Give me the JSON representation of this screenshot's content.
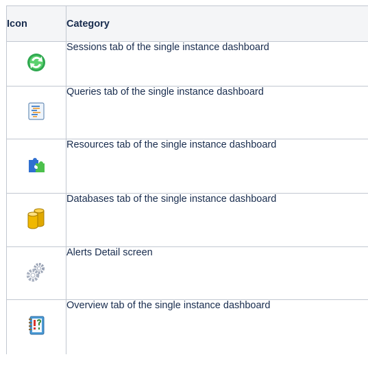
{
  "table": {
    "headers": {
      "icon": "Icon",
      "category": "Category"
    },
    "rows": [
      {
        "icon": "sessions-icon",
        "category": "Sessions tab of the single instance dashboard"
      },
      {
        "icon": "queries-icon",
        "category": "Queries tab of the single instance dashboard"
      },
      {
        "icon": "resources-icon",
        "category": "Resources tab of the single instance dashboard"
      },
      {
        "icon": "databases-icon",
        "category": "Databases tab of the single instance dashboard"
      },
      {
        "icon": "alerts-icon",
        "category": "Alerts Detail screen"
      },
      {
        "icon": "overview-icon",
        "category": "Overview tab of the single instance dashboard"
      }
    ]
  }
}
